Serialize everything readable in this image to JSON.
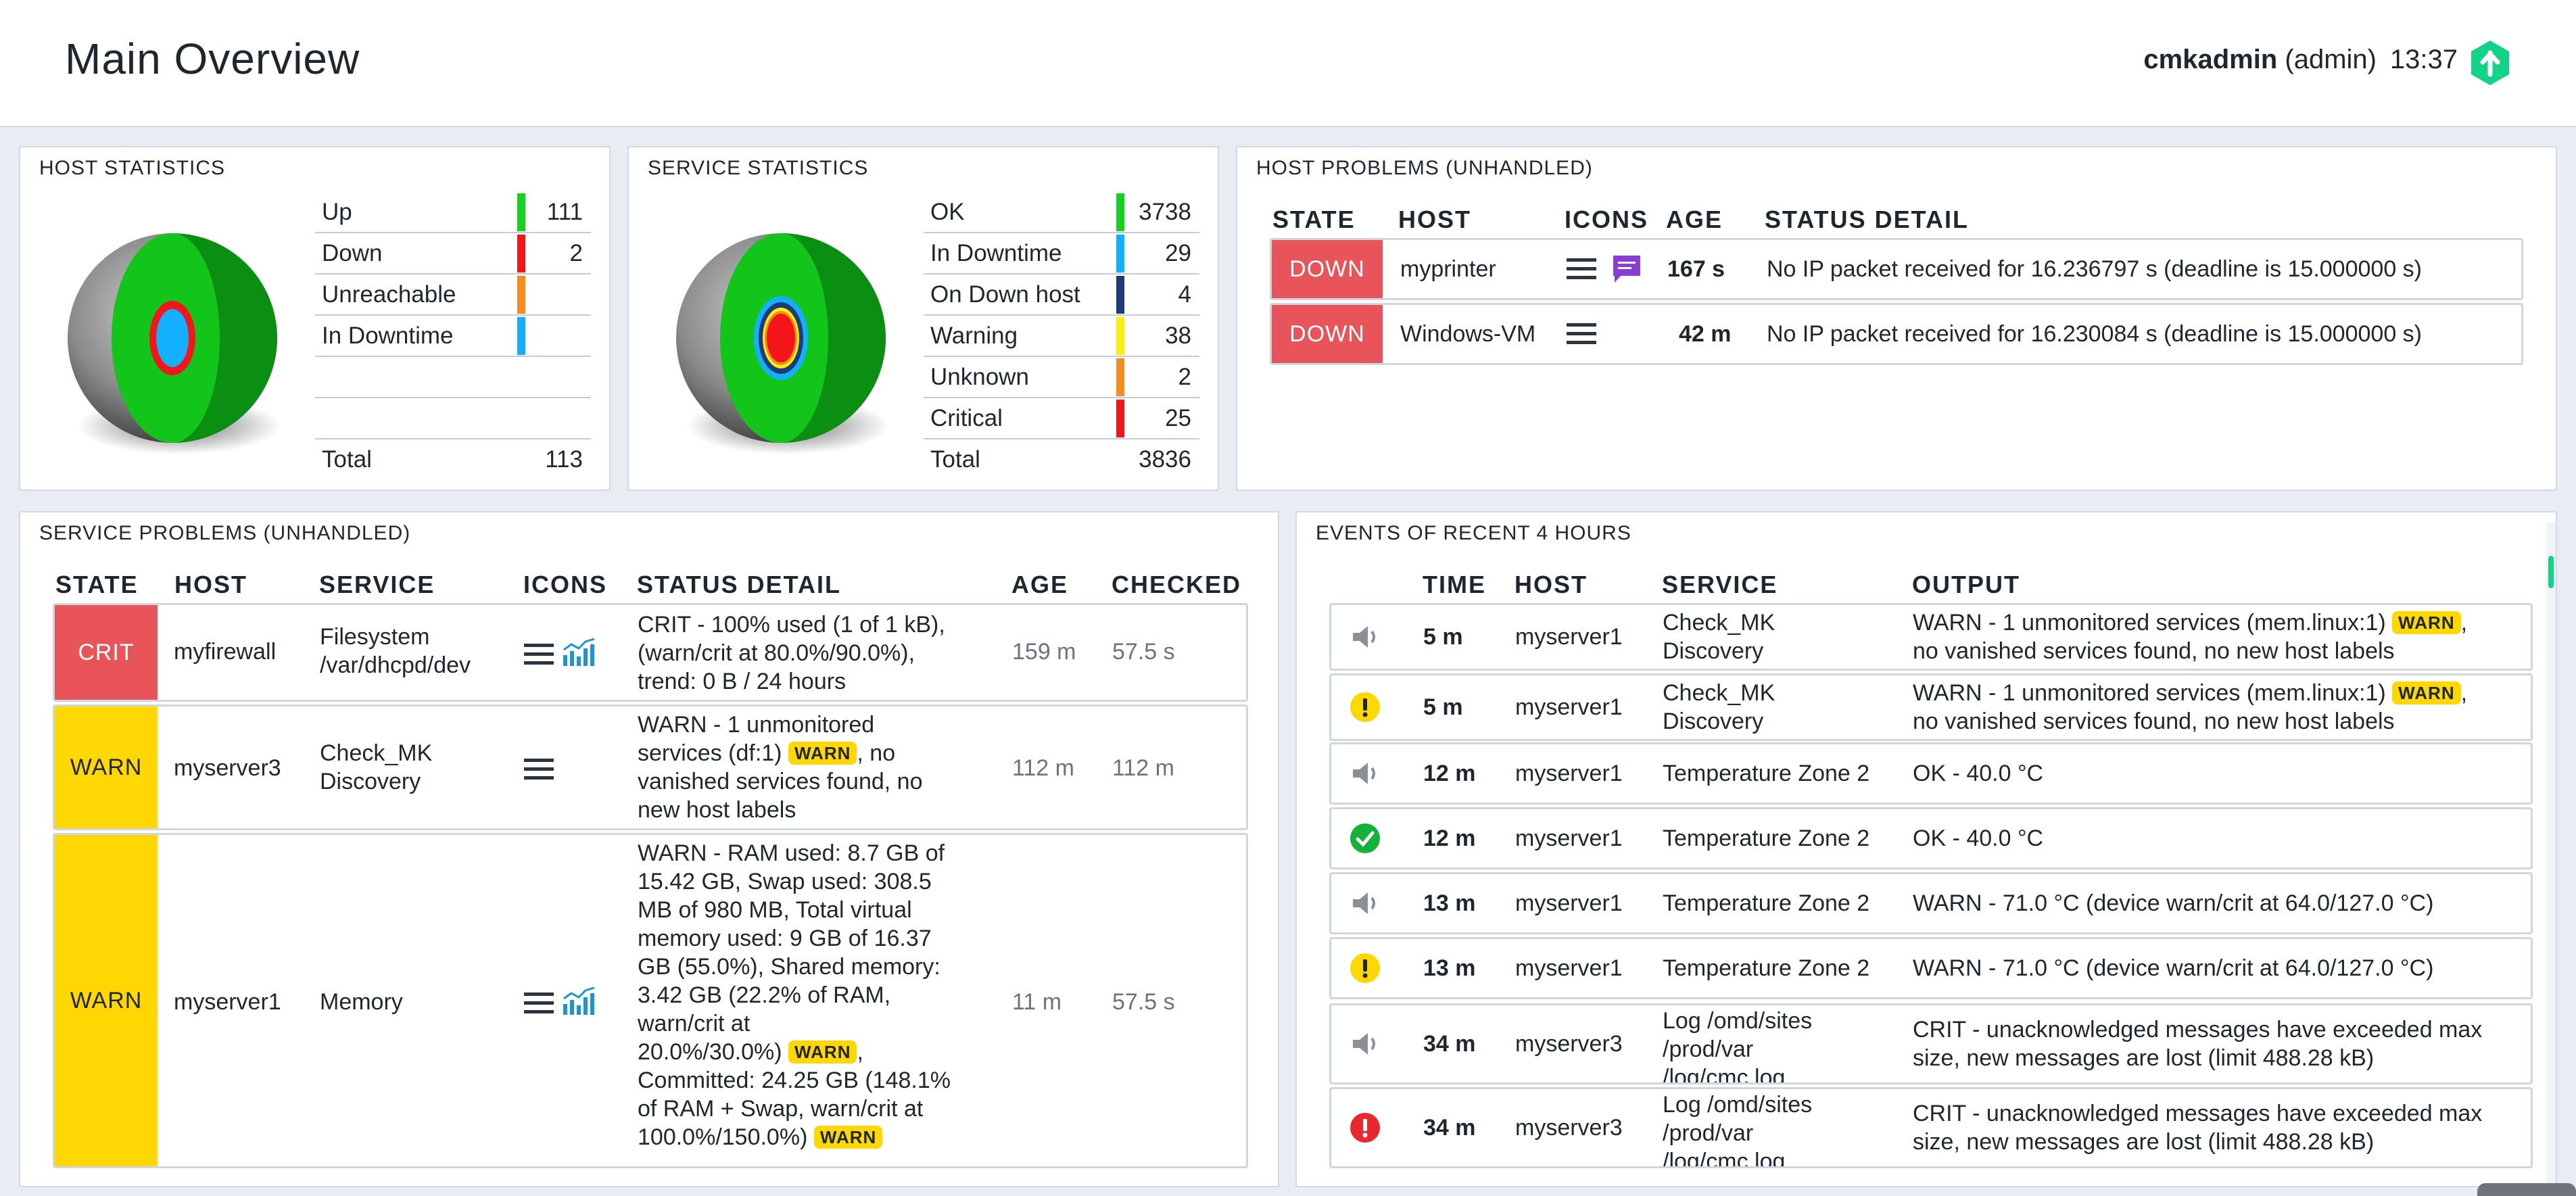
{
  "header": {
    "title": "Main Overview",
    "user": "cmkadmin",
    "role": "(admin)",
    "time": "13:37"
  },
  "host_stats": {
    "title": "HOST STATISTICS",
    "rows": [
      {
        "label": "Up",
        "color": "#13d31d",
        "value": "111"
      },
      {
        "label": "Down",
        "color": "#f4151a",
        "value": "2"
      },
      {
        "label": "Unreachable",
        "color": "#f68b1f",
        "value": ""
      },
      {
        "label": "In Downtime",
        "color": "#13b0ff",
        "value": ""
      },
      {
        "label": "",
        "color": "",
        "value": ""
      },
      {
        "label": "",
        "color": "",
        "value": ""
      },
      {
        "label": "Total",
        "color": "",
        "value": "113"
      }
    ]
  },
  "service_stats": {
    "title": "SERVICE STATISTICS",
    "rows": [
      {
        "label": "OK",
        "color": "#13d31d",
        "value": "3738"
      },
      {
        "label": "In Downtime",
        "color": "#13b0ff",
        "value": "29"
      },
      {
        "label": "On Down host",
        "color": "#1f3b7a",
        "value": "4"
      },
      {
        "label": "Warning",
        "color": "#f8f10f",
        "value": "38"
      },
      {
        "label": "Unknown",
        "color": "#f68b1f",
        "value": "2"
      },
      {
        "label": "Critical",
        "color": "#f4151a",
        "value": "25"
      },
      {
        "label": "Total",
        "color": "",
        "value": "3836"
      }
    ]
  },
  "host_problems": {
    "title": "HOST PROBLEMS (UNHANDLED)",
    "headers": [
      "STATE",
      "HOST",
      "ICONS",
      "AGE",
      "STATUS DETAIL"
    ],
    "rows": [
      {
        "state": "DOWN",
        "host": "myprinter",
        "age": "167 s",
        "detail": "No IP packet received for 16.236797 s (deadline is 15.000000 s)"
      },
      {
        "state": "DOWN",
        "host": "Windows-VM",
        "age": "42 m",
        "detail": "No IP packet received for 16.230084 s (deadline is 15.000000 s)"
      }
    ]
  },
  "service_problems": {
    "title": "SERVICE PROBLEMS (UNHANDLED)",
    "headers": [
      "STATE",
      "HOST",
      "SERVICE",
      "ICONS",
      "STATUS DETAIL",
      "AGE",
      "CHECKED"
    ],
    "rows": [
      {
        "state": "CRIT",
        "host": "myfirewall",
        "service_l1": "Filesystem",
        "service_l2": "/var/dhcpd/dev",
        "detail": [
          "CRIT - 100% used (1 of 1 kB),",
          "(warn/crit at 80.0%/90.0%),",
          "trend: 0 B / 24 hours"
        ],
        "age": "159 m",
        "checked": "57.5 s"
      },
      {
        "state": "WARN",
        "host": "myserver3",
        "service_l1": "Check_MK",
        "service_l2": "Discovery",
        "detail": [
          "WARN - 1 unmonitored",
          "services (df:1)",
          ", no",
          "vanished services found, no",
          "new host labels"
        ],
        "age": "112 m",
        "checked": "112 m"
      },
      {
        "state": "WARN",
        "host": "myserver1",
        "service_l1": "Memory",
        "service_l2": "",
        "detail": [
          "WARN - RAM used: 8.7 GB of",
          "15.42 GB, Swap used: 308.5",
          "MB of 980 MB, Total virtual",
          "memory used: 9 GB of 16.37",
          "GB (55.0%), Shared memory:",
          "3.42 GB (22.2% of RAM,",
          "warn/crit at",
          "20.0%/30.0%)",
          ",",
          "Committed: 24.25 GB (148.1%",
          "of RAM + Swap, warn/crit at",
          "100.0%/150.0%)"
        ],
        "age": "11 m",
        "checked": "57.5 s"
      }
    ],
    "badge": "WARN"
  },
  "events": {
    "title": "EVENTS OF RECENT 4 HOURS",
    "headers": [
      "TIME",
      "HOST",
      "SERVICE",
      "OUTPUT"
    ],
    "badge": "WARN",
    "rows": [
      {
        "icon": "speaker-icon",
        "time": "5 m",
        "host": "myserver1",
        "service": [
          "Check_MK",
          "Discovery"
        ],
        "output": [
          "WARN - 1 unmonitored services (mem.linux:1)",
          "no vanished services found, no new host labels"
        ]
      },
      {
        "icon": "warning-circle-icon",
        "time": "5 m",
        "host": "myserver1",
        "service": [
          "Check_MK",
          "Discovery"
        ],
        "output": [
          "WARN - 1 unmonitored services (mem.linux:1)",
          "no vanished services found, no new host labels"
        ]
      },
      {
        "icon": "speaker-icon",
        "time": "12 m",
        "host": "myserver1",
        "service": [
          "Temperature Zone 2"
        ],
        "output": [
          "OK - 40.0 °C"
        ]
      },
      {
        "icon": "ok-circle-icon",
        "time": "12 m",
        "host": "myserver1",
        "service": [
          "Temperature Zone 2"
        ],
        "output": [
          "OK - 40.0 °C"
        ]
      },
      {
        "icon": "speaker-icon",
        "time": "13 m",
        "host": "myserver1",
        "service": [
          "Temperature Zone 2"
        ],
        "output": [
          "WARN - 71.0 °C (device warn/crit at 64.0/127.0 °C)"
        ]
      },
      {
        "icon": "warning-circle-icon",
        "time": "13 m",
        "host": "myserver1",
        "service": [
          "Temperature Zone 2"
        ],
        "output": [
          "WARN - 71.0 °C (device warn/crit at 64.0/127.0 °C)"
        ]
      },
      {
        "icon": "speaker-icon",
        "time": "34 m",
        "host": "myserver3",
        "service": [
          "Log /omd/sites",
          "/prod/var",
          "/log/cmc.log"
        ],
        "output": [
          "CRIT - unacknowledged messages have exceeded max",
          "size, new messages are lost (limit 488.28 kB)"
        ]
      },
      {
        "icon": "crit-circle-icon",
        "time": "34 m",
        "host": "myserver3",
        "service": [
          "Log /omd/sites",
          "/prod/var",
          "/log/cmc.log"
        ],
        "output": [
          "CRIT - unacknowledged messages have exceeded max",
          "size, new messages are lost (limit 488.28 kB)"
        ]
      }
    ]
  },
  "colors": {
    "crit": "#e8545a",
    "warn": "#ffd703",
    "ok": "#13d31d",
    "accent": "#13d389",
    "graph_icon": "#1a96d4",
    "comment_icon": "#8a3dd1"
  }
}
